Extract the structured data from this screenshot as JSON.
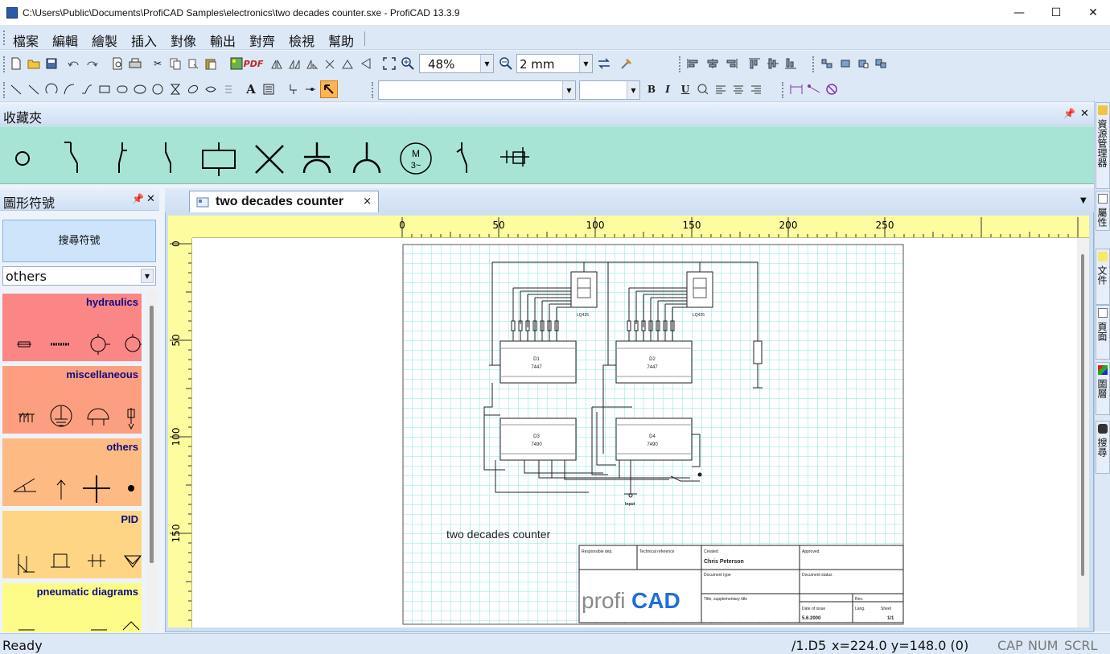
{
  "window": {
    "title": "C:\\Users\\Public\\Documents\\ProfiCAD Samples\\electronics\\two decades counter.sxe - ProfiCAD 13.3.9",
    "min": "—",
    "max": "☐",
    "close": "✕"
  },
  "menu": [
    "檔案",
    "編輯",
    "繪製",
    "插入",
    "對像",
    "輸出",
    "對齊",
    "檢視",
    "幫助"
  ],
  "toolbar": {
    "zoom": "48%",
    "grid": "2 mm",
    "pdf_label": "PDF",
    "font_name": "",
    "font_size": "",
    "bold": "B",
    "italic": "I",
    "underline": "U"
  },
  "favorites": {
    "title": "收藏夾",
    "motor_label": "M",
    "motor_sub": "3~"
  },
  "symbols_panel": {
    "title": "圖形符號",
    "search_button": "搜尋符號",
    "category": "others",
    "categories": [
      {
        "name": "hydraulics",
        "color": "#fb8686"
      },
      {
        "name": "miscellaneous",
        "color": "#fc9f80"
      },
      {
        "name": "others",
        "color": "#fdba82"
      },
      {
        "name": "PID",
        "color": "#fed584"
      },
      {
        "name": "pneumatic diagrams",
        "color": "#fefc88"
      }
    ]
  },
  "document": {
    "tab_title": "two decades counter",
    "tab_close": "×",
    "ruler_h": [
      "0",
      "50",
      "100",
      "150",
      "200",
      "250"
    ],
    "ruler_v": [
      "0",
      "50",
      "100",
      "150"
    ],
    "drawing_title": "two decades counter",
    "ic_labels": [
      "D1",
      "D2",
      "D3",
      "D4"
    ],
    "ic_types": [
      "7447",
      "7447",
      "7490",
      "7490"
    ],
    "display_label": "LQ425",
    "input_label": "Input",
    "titleblock": {
      "responsible": "Responsible dep.",
      "technical": "Technical reference",
      "created": "Created",
      "approved": "Approved",
      "author": "Chris Peterson",
      "doc_type": "Document type",
      "doc_status": "Document status",
      "title_sub": "Title, supplementary title",
      "rev": "Rev.",
      "date_issue": "Date of issue",
      "lang": "Lang.",
      "sheet": "Sheet",
      "date_value": "5.6.2000",
      "sheet_value": "1/1",
      "logo_a": "profi",
      "logo_b": "CAD"
    }
  },
  "right_tabs": [
    "資源管理器",
    "屬性",
    "文件",
    "頁面",
    "圖層",
    "搜尋"
  ],
  "status": {
    "ready": "Ready",
    "page": "/1.D5",
    "coords": "x=224.0  y=148.0 (0)",
    "cap": "CAP",
    "num": "NUM",
    "scrl": "SCRL"
  },
  "colors": {
    "favorites_bg": "#a8e4d5",
    "ruler": "#fdfd9f",
    "grid": "#88e4ef",
    "logo_blue": "#1e6fd8"
  }
}
